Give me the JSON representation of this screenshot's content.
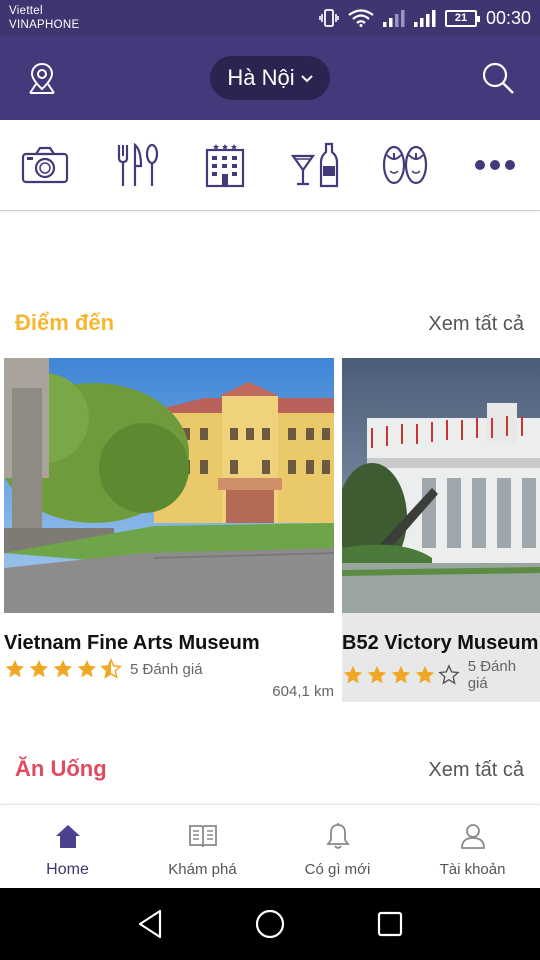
{
  "status_bar": {
    "carrier_1": "Viettel",
    "carrier_2": "VINAPHONE",
    "battery": "21",
    "time": "00:30"
  },
  "header": {
    "city": "Hà Nội",
    "left_icon": "location-pin-icon",
    "right_icon": "search-icon"
  },
  "categories": [
    {
      "icon": "camera-icon"
    },
    {
      "icon": "cutlery-icon"
    },
    {
      "icon": "hotel-icon"
    },
    {
      "icon": "drinks-icon"
    },
    {
      "icon": "flip-flops-icon"
    },
    {
      "icon": "more-icon"
    }
  ],
  "section_destinations": {
    "title": "Điểm đến",
    "see_all": "Xem tất cả",
    "title_color": "#f5b731"
  },
  "places": [
    {
      "name": "Vietnam Fine Arts Museum",
      "rating": 4.5,
      "reviews": "5 Đánh giá",
      "distance": "604,1 km"
    },
    {
      "name": "B52 Victory Museum",
      "rating": 4,
      "reviews": "5 Đánh giá"
    }
  ],
  "section_food": {
    "title": "Ăn Uống",
    "see_all": "Xem tất cả",
    "title_color": "#e04b5f"
  },
  "bottom_nav": [
    {
      "label": "Home",
      "icon": "home-icon",
      "active": true
    },
    {
      "label": "Khám phá",
      "icon": "book-icon",
      "active": false
    },
    {
      "label": "Có gì mới",
      "icon": "bell-icon",
      "active": false
    },
    {
      "label": "Tài khoản",
      "icon": "user-icon",
      "active": false
    }
  ],
  "colors": {
    "primary": "#423a7b",
    "star": "#f0a824"
  }
}
